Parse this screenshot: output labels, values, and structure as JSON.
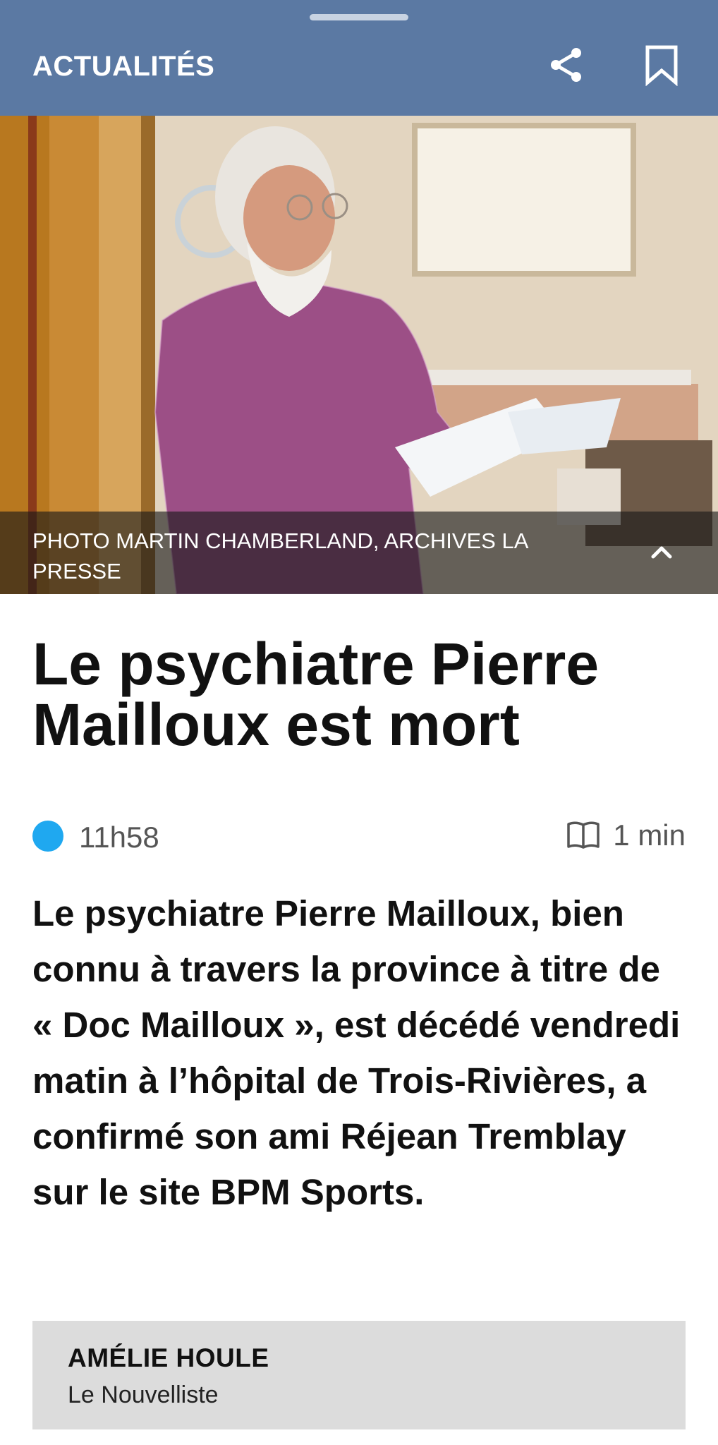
{
  "header": {
    "section": "ACTUALITÉS",
    "share_icon": "share-icon",
    "bookmark_icon": "bookmark-icon",
    "background": "#5b79a3"
  },
  "photo": {
    "caption": "PHOTO MARTIN CHAMBERLAND, ARCHIVES LA PRESSE",
    "toggle_icon": "chevron-up-icon"
  },
  "article": {
    "headline": "Le psychiatre Pierre Mailloux est mort",
    "time": "11h58",
    "read_time": "1 min",
    "live_indicator_color": "#1fa8f0",
    "lede": "Le psychiatre Pierre Mailloux, bien connu à travers la province à titre de « Doc Mailloux », est décédé vendredi matin à l’hôpital de Trois-Rivières, a confirmé son ami Réjean Tremblay sur le site BPM Sports."
  },
  "author": {
    "name": "AMÉLIE HOULE",
    "organization": "Le Nouvelliste"
  }
}
